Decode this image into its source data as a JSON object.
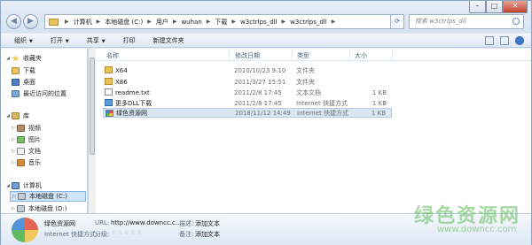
{
  "address": {
    "crumbs": [
      "计算机",
      "本地磁盘 (C:)",
      "用户",
      "wuhan",
      "下载",
      "w3ctrlps_dll",
      "w3ctrlps_dll"
    ],
    "search_placeholder": "搜索 w3ctrlps_dll"
  },
  "toolbar": {
    "organize": "组织",
    "open": "打开",
    "share": "共享",
    "print": "打印",
    "new_folder": "新建文件夹"
  },
  "nav": {
    "favorites": "收藏夹",
    "downloads": "下载",
    "desktop": "桌面",
    "recent": "最近访问的位置",
    "libraries": "库",
    "videos": "视频",
    "pictures": "图片",
    "documents": "文档",
    "music": "音乐",
    "computer": "计算机",
    "drive_c": "本地磁盘 (C:)",
    "drive_d": "本地磁盘 (D:)"
  },
  "columns": {
    "name": "名称",
    "date": "修改日期",
    "type": "类型",
    "size": "大小"
  },
  "files": [
    {
      "name": "X64",
      "date": "2010/10/23 9:10",
      "type": "文件夹",
      "size": ""
    },
    {
      "name": "X86",
      "date": "2011/3/27 15:51",
      "type": "文件夹",
      "size": ""
    },
    {
      "name": "readme.txt",
      "date": "2011/2/8 17:45",
      "type": "文本文档",
      "size": "1 KB"
    },
    {
      "name": "更多DLL下载",
      "date": "2011/2/8 17:45",
      "type": "Internet 快捷方式",
      "size": "1 KB"
    },
    {
      "name": "绿色资源网",
      "date": "2018/11/12 14:49",
      "type": "Internet 快捷方式",
      "size": "1 KB"
    }
  ],
  "details": {
    "name": "绿色资源网",
    "kind": "Internet 快捷方式",
    "url_label": "URL:",
    "url_value": "http://www.downcc.c...",
    "rating_label": "分级:",
    "desc_label": "描述:",
    "desc_value": "添加文本",
    "comment_label": "备注:",
    "comment_value": "添加文本"
  },
  "watermark": {
    "cn": "绿色资源网",
    "url": "www.downcc.com"
  }
}
